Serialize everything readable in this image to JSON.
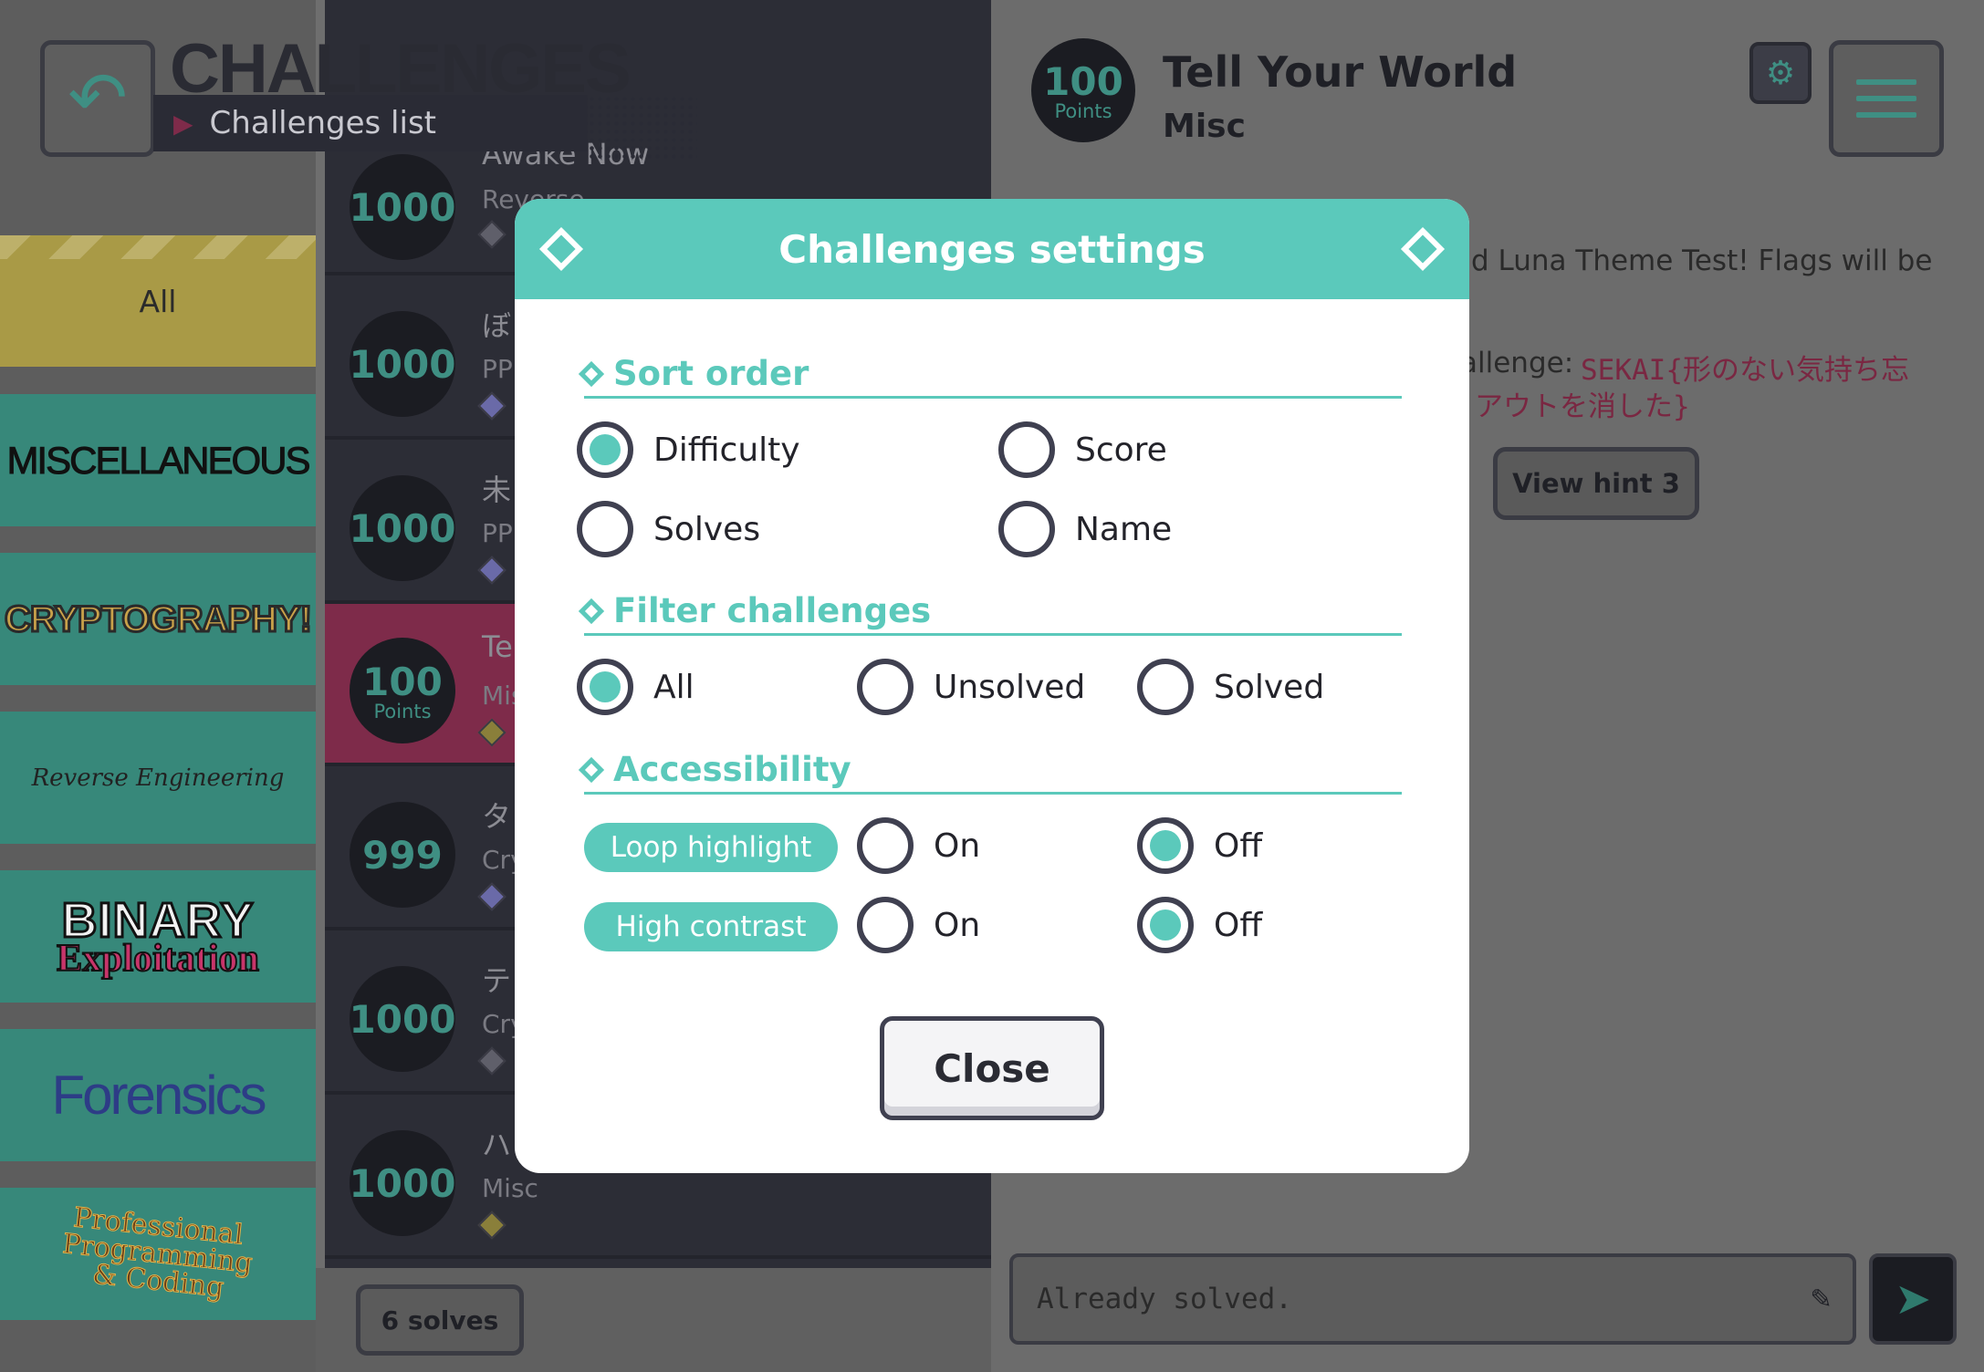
{
  "header": {
    "title": "CHALLENGES",
    "subtitle": "Challenges list"
  },
  "categories": [
    {
      "label": "All"
    },
    {
      "label": "MISCELLANEOUS"
    },
    {
      "label": "CRYPTOGRAPHY!"
    },
    {
      "label": "Reverse Engineering"
    },
    {
      "label_line1": "BINARY",
      "label_line2": "Exploitation"
    },
    {
      "label": "Forensics"
    },
    {
      "label_line1": "Professional",
      "label_line2": "Programming",
      "label_line3": "& Coding"
    }
  ],
  "list": {
    "rows": [
      {
        "points": "1000",
        "name": "Awake Now",
        "category": "Reverse"
      },
      {
        "points": "1000",
        "name": "ぼ",
        "category": "PP"
      },
      {
        "points": "1000",
        "name": "未",
        "category": "PP"
      },
      {
        "points": "100",
        "points_label": "Points",
        "name": "Te",
        "category": "Mis"
      },
      {
        "points": "999",
        "name": "タ",
        "category": "Cry"
      },
      {
        "points": "1000",
        "name": "テ",
        "category": "Cry"
      },
      {
        "points": "1000",
        "name": "ハ",
        "category": "Misc"
      }
    ],
    "solves_button": "6 solves"
  },
  "detail": {
    "points": "100",
    "points_label": "Points",
    "title": "Tell Your World",
    "category": "Misc",
    "text_line1": "d Luna Theme Test! Flags will be",
    "text_line2": "allenge:",
    "flag_line1": "SEKAI{形のない気持ち忘",
    "flag_line2": "アウトを消した}",
    "hint_button": "View hint 3",
    "flag_input_placeholder": "Already solved.",
    "icons": {
      "settings": "gear-icon",
      "menu": "hamburger-menu-icon",
      "edit": "pencil-icon",
      "send": "send-icon",
      "back": "back-arrow-icon"
    }
  },
  "modal": {
    "title": "Challenges settings",
    "sort": {
      "title": "Sort order",
      "options": [
        "Difficulty",
        "Score",
        "Solves",
        "Name"
      ],
      "selected": "Difficulty"
    },
    "filter": {
      "title": "Filter challenges",
      "options": [
        "All",
        "Unsolved",
        "Solved"
      ],
      "selected": "All"
    },
    "accessibility": {
      "title": "Accessibility",
      "loop_highlight": {
        "label": "Loop highlight",
        "on": "On",
        "off": "Off",
        "selected": "Off"
      },
      "high_contrast": {
        "label": "High contrast",
        "on": "On",
        "off": "Off",
        "selected": "Off"
      }
    },
    "close_button": "Close"
  },
  "colors": {
    "accent": "#5bc9bb",
    "active_row": "#7e2b4a",
    "dark": "#2c2d36"
  }
}
